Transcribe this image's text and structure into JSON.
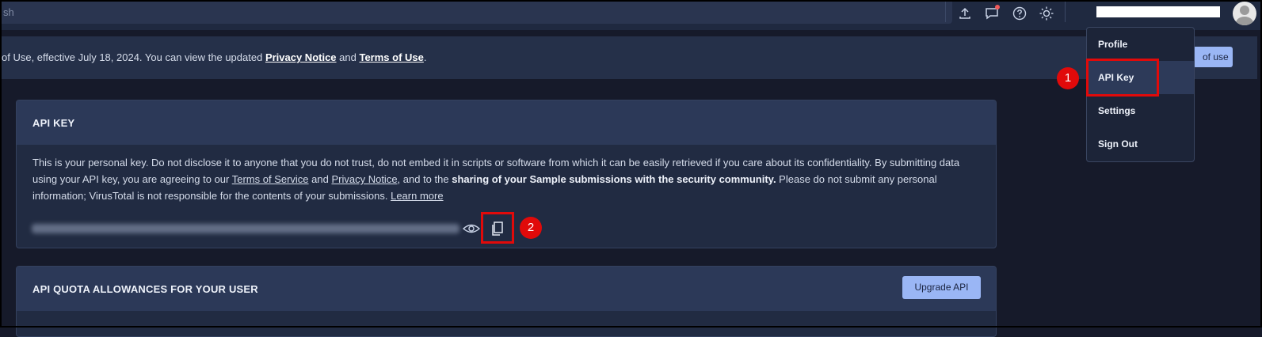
{
  "search": {
    "partial_placeholder": "sh"
  },
  "topbar": {
    "icons": [
      "upload-icon",
      "chat-icon",
      "help-icon",
      "theme-icon"
    ]
  },
  "notice": {
    "text_before": "of Use, effective July 18, 2024. You can view the updated ",
    "privacy_link": "Privacy Notice",
    "and": " and ",
    "terms_link": "Terms of Use",
    "period": ".",
    "button_label": "of use"
  },
  "api_key_panel": {
    "title": "API KEY",
    "body_1": "This is your personal key. Do not disclose it to anyone that you do not trust, do not embed it in scripts or software from which it can be easily retrieved if you care about its confidentiality. By submitting data using your API key, you are agreeing to our ",
    "tos_link": "Terms of Service",
    "body_2": " and ",
    "privacy_link": "Privacy Notice",
    "body_3": ", and to the ",
    "bold": "sharing of your Sample submissions with the security community.",
    "body_4": " Please do not submit any personal information; VirusTotal is not responsible for the contents of your submissions. ",
    "learn_more": "Learn more"
  },
  "quota_panel": {
    "title": "API QUOTA ALLOWANCES FOR YOUR USER",
    "button_label": "Upgrade API"
  },
  "menu": {
    "items": [
      {
        "label": "Profile"
      },
      {
        "label": "API Key"
      },
      {
        "label": "Settings"
      },
      {
        "label": "Sign Out"
      }
    ]
  },
  "annotations": {
    "badge_1": "1",
    "badge_2": "2"
  },
  "colors": {
    "accent": "#9ab6f5",
    "highlight": "#e10a0a",
    "background": "#161a2a"
  }
}
